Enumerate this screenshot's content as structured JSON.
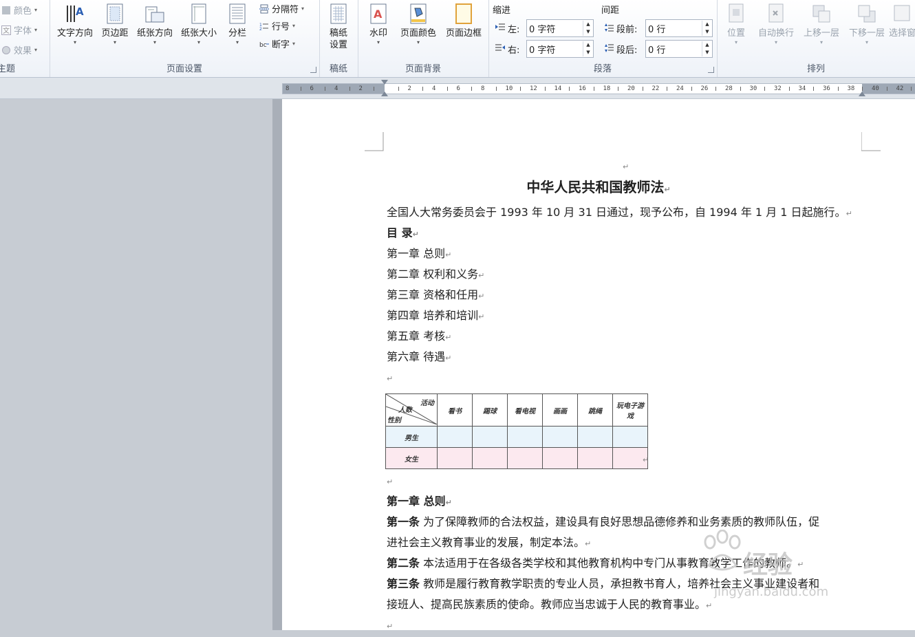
{
  "ribbon": {
    "theme_group": {
      "items": [
        "颜色",
        "字体",
        "效果"
      ],
      "label": "主题"
    },
    "page_setup": {
      "label": "页面设置",
      "buttons": [
        "文字方向",
        "页边距",
        "纸张方向",
        "纸张大小",
        "分栏"
      ],
      "small_buttons": [
        "分隔符",
        "行号",
        "断字"
      ]
    },
    "manuscript": {
      "label": "稿纸",
      "button_line1": "稿纸",
      "button_line2": "设置"
    },
    "page_background": {
      "label": "页面背景",
      "buttons": [
        "水印",
        "页面颜色",
        "页面边框"
      ]
    },
    "paragraph": {
      "label": "段落",
      "indent_title": "缩进",
      "spacing_title": "间距",
      "left_label": "左:",
      "left_value": "0 字符",
      "right_label": "右:",
      "right_value": "0 字符",
      "before_label": "段前:",
      "before_value": "0 行",
      "after_label": "段后:",
      "after_value": "0 行"
    },
    "arrange": {
      "label": "排列",
      "buttons": [
        "位置",
        "自动换行",
        "上移一层",
        "下移一层",
        "选择窗"
      ]
    }
  },
  "ruler": {
    "ticks": [
      "8",
      "6",
      "4",
      "2",
      "",
      "2",
      "4",
      "6",
      "8",
      "10",
      "12",
      "14",
      "16",
      "18",
      "20",
      "22",
      "24",
      "26",
      "28",
      "30",
      "32",
      "34",
      "36",
      "38",
      "40",
      "42"
    ]
  },
  "document": {
    "title": "中华人民共和国教师法",
    "intro": "全国人大常务委员会于 1993 年 10 月 31 日通过，现予公布，自 1994 年 1 月 1 日起施行。",
    "toc_title": "目  录",
    "toc": [
      "第一章  总则",
      "第二章  权利和义务",
      "第三章  资格和任用",
      "第四章  培养和培训",
      "第五章  考核",
      "第六章  待遇"
    ],
    "table": {
      "corner_top": "活动",
      "corner_mid": "人数",
      "corner_bottom": "性别",
      "columns": [
        "看书",
        "踢球",
        "看电视",
        "画画",
        "跳绳",
        "玩电子游戏"
      ],
      "rows": [
        "男生",
        "女生"
      ]
    },
    "chapter1_title": "第一章  总则",
    "art1_label": "第一条",
    "art1_text1": " 为了保障教师的合法权益，建设具有良好思想品德修养和业务素质的教师队伍，促",
    "art1_text2": "进社会主义教育事业的发展，制定本法。",
    "art2_label": "第二条",
    "art2_text": " 本法适用于在各级各类学校和其他教育机构中专门从事教育教学工作的教师。",
    "art3_label": "第三条",
    "art3_text1": " 教师是履行教育教学职责的专业人员，承担教书育人，培养社会主义事业建设者和",
    "art3_text2": "接班人、提高民族素质的使命。教师应当忠诚于人民的教育事业。",
    "para_mark": "↵"
  },
  "watermark": {
    "text": "经验",
    "url": "jingyan.baidu.com"
  }
}
